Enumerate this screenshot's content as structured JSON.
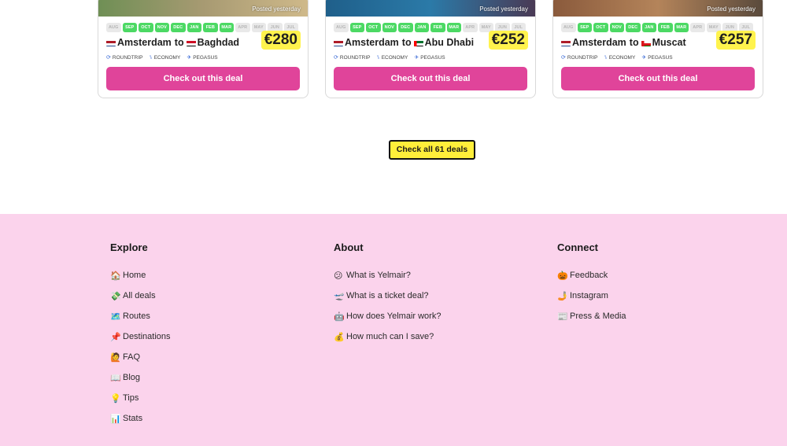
{
  "deals": [
    {
      "posted": "Posted yesterday",
      "from": "Amsterdam",
      "to_word": "to",
      "dest": "Baghdad",
      "price": "€280",
      "photo_colors": [
        "#6f8f55",
        "#a79a72",
        "#cfb98a"
      ],
      "months": [
        {
          "label": "AUG",
          "on": false
        },
        {
          "label": "SEP",
          "on": true
        },
        {
          "label": "OCT",
          "on": true
        },
        {
          "label": "NOV",
          "on": true
        },
        {
          "label": "DEC",
          "on": true
        },
        {
          "label": "JAN",
          "on": true
        },
        {
          "label": "FEB",
          "on": true
        },
        {
          "label": "MAR",
          "on": true
        },
        {
          "label": "APR",
          "on": false
        },
        {
          "label": "MAY",
          "on": false
        },
        {
          "label": "JUN",
          "on": false
        },
        {
          "label": "JUL",
          "on": false
        }
      ],
      "meta": {
        "trip": "ROUNDTRIP",
        "class": "ECONOMY",
        "airline": "PEGASUS"
      },
      "button": "Check out this deal"
    },
    {
      "posted": "Posted yesterday",
      "from": "Amsterdam",
      "to_word": "to",
      "dest": "Abu Dhabi",
      "price": "€252",
      "photo_colors": [
        "#1f5f8a",
        "#2b7aa8",
        "#4a3a55"
      ],
      "months": [
        {
          "label": "AUG",
          "on": false
        },
        {
          "label": "SEP",
          "on": true
        },
        {
          "label": "OCT",
          "on": true
        },
        {
          "label": "NOV",
          "on": true
        },
        {
          "label": "DEC",
          "on": true
        },
        {
          "label": "JAN",
          "on": true
        },
        {
          "label": "FEB",
          "on": true
        },
        {
          "label": "MAR",
          "on": true
        },
        {
          "label": "APR",
          "on": false
        },
        {
          "label": "MAY",
          "on": false
        },
        {
          "label": "JUN",
          "on": false
        },
        {
          "label": "JUL",
          "on": false
        }
      ],
      "meta": {
        "trip": "ROUNDTRIP",
        "class": "ECONOMY",
        "airline": "PEGASUS"
      },
      "button": "Check out this deal"
    },
    {
      "posted": "Posted yesterday",
      "from": "Amsterdam",
      "to_word": "to",
      "dest": "Muscat",
      "price": "€257",
      "photo_colors": [
        "#8a5a3c",
        "#b4845a",
        "#5a4a3c"
      ],
      "months": [
        {
          "label": "AUG",
          "on": false
        },
        {
          "label": "SEP",
          "on": true
        },
        {
          "label": "OCT",
          "on": true
        },
        {
          "label": "NOV",
          "on": true
        },
        {
          "label": "DEC",
          "on": true
        },
        {
          "label": "JAN",
          "on": true
        },
        {
          "label": "FEB",
          "on": true
        },
        {
          "label": "MAR",
          "on": true
        },
        {
          "label": "APR",
          "on": false
        },
        {
          "label": "MAY",
          "on": false
        },
        {
          "label": "JUN",
          "on": false
        },
        {
          "label": "JUL",
          "on": false
        }
      ],
      "meta": {
        "trip": "ROUNDTRIP",
        "class": "ECONOMY",
        "airline": "PEGASUS"
      },
      "button": "Check out this deal"
    }
  ],
  "all_deals_label": "Check all 61 deals",
  "footer": {
    "explore": {
      "title": "Explore",
      "items": [
        {
          "icon": "🏠",
          "label": "Home"
        },
        {
          "icon": "💸",
          "label": "All deals"
        },
        {
          "icon": "🗺️",
          "label": "Routes"
        },
        {
          "icon": "📌",
          "label": "Destinations"
        },
        {
          "icon": "🙋",
          "label": "FAQ"
        },
        {
          "icon": "📖",
          "label": "Blog"
        },
        {
          "icon": "💡",
          "label": "Tips"
        },
        {
          "icon": "📊",
          "label": "Stats"
        }
      ]
    },
    "about": {
      "title": "About",
      "items": [
        {
          "icon": "😕",
          "label": "What is Yelmair?"
        },
        {
          "icon": "🛫",
          "label": "What is a ticket deal?"
        },
        {
          "icon": "🤖",
          "label": "How does Yelmair work?"
        },
        {
          "icon": "💰",
          "label": "How much can I save?"
        }
      ]
    },
    "connect": {
      "title": "Connect",
      "items": [
        {
          "icon": "🎃",
          "label": "Feedback"
        },
        {
          "icon": "🤳",
          "label": "Instagram"
        },
        {
          "icon": "📰",
          "label": "Press & Media"
        }
      ]
    }
  },
  "colors": {
    "accent_button": "#e0449a",
    "price_highlight": "#fff34d",
    "month_active": "#4cd964",
    "footer_bg": "#fbd3ec",
    "cta_yellow": "#ffef3a"
  }
}
